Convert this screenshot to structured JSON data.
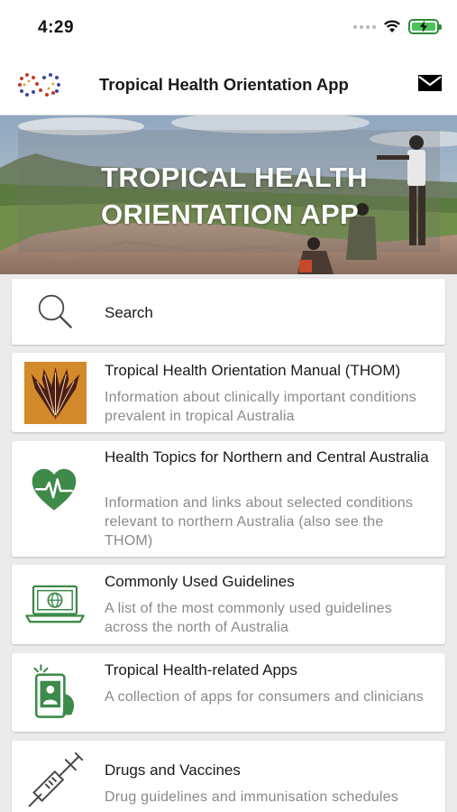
{
  "status_bar": {
    "time": "4:29"
  },
  "header": {
    "title": "Tropical Health Orientation App"
  },
  "banner": {
    "title": "TROPICAL HEALTH\nORIENTATION APP"
  },
  "menu": [
    {
      "title": "Search",
      "icon": "search-icon"
    },
    {
      "title": "Tropical Health Orientation Manual (THOM)",
      "description": "Information about clinically important conditions prevalent in tropical Australia",
      "icon": "thom-artwork-icon"
    },
    {
      "title": "Health Topics for Northern and Central Australia",
      "description": "Information and links about selected conditions relevant to northern Australia (also see the THOM)",
      "icon": "heart-pulse-icon"
    },
    {
      "title": "Commonly Used Guidelines",
      "description": "A list of the most commonly used guidelines across the north of Australia",
      "icon": "laptop-globe-icon"
    },
    {
      "title": "Tropical Health-related Apps",
      "description": "A collection of apps for consumers and clinicians",
      "icon": "phone-app-icon"
    },
    {
      "title": "Drugs and Vaccines",
      "description": "Drug guidelines and immunisation schedules",
      "icon": "syringe-icon"
    }
  ],
  "colors": {
    "icon_green": "#3d8a4a",
    "background": "#ebebeb",
    "desc_gray": "#8a8a8a"
  }
}
